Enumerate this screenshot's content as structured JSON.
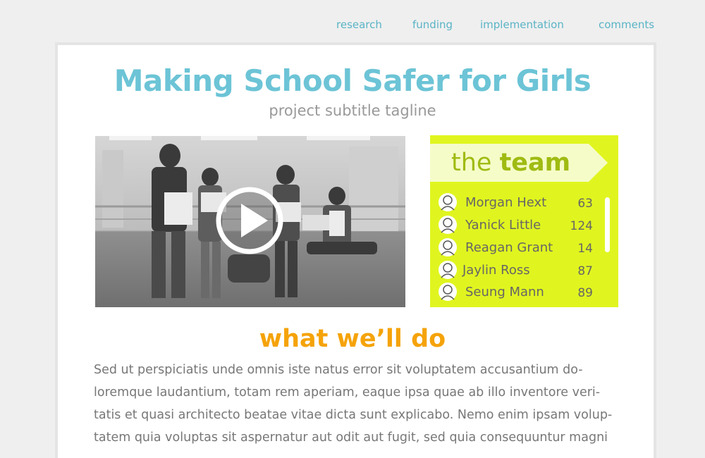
{
  "nav": {
    "items": [
      {
        "label": "research"
      },
      {
        "label": "funding"
      },
      {
        "label": "implementation"
      },
      {
        "label": "comments"
      }
    ]
  },
  "project": {
    "title": "Making School Safer for Girls",
    "subtitle": "project subtitle tagline"
  },
  "video": {
    "play_icon": "play-icon"
  },
  "team": {
    "heading_light": "the ",
    "heading_bold": "team",
    "members": [
      {
        "name": "Morgan Hext",
        "count": "63"
      },
      {
        "name": "Yanick Little",
        "count": "124"
      },
      {
        "name": "Reagan Grant",
        "count": "14"
      },
      {
        "name": "Jaylin Ross",
        "count": "87"
      },
      {
        "name": "Seung Mann",
        "count": "89"
      }
    ]
  },
  "plan": {
    "heading_a": "what",
    "heading_b": " we’ll ",
    "heading_c": "do",
    "lines": [
      "Sed ut perspiciatis unde omnis iste natus error sit voluptatem accusantium do-",
      "loremque laudantium, totam rem aperiam, eaque ipsa quae ab illo inventore veri-",
      "tatis et quasi architecto beatae vitae dicta sunt explicabo. Nemo enim ipsam volup-",
      "tatem quia voluptas sit aspernatur aut odit aut fugit, sed quia consequuntur magni"
    ]
  },
  "colors": {
    "accent_blue": "#6cc4d6",
    "team_green": "#e0f51f",
    "heading_orange": "#f5a30a"
  }
}
